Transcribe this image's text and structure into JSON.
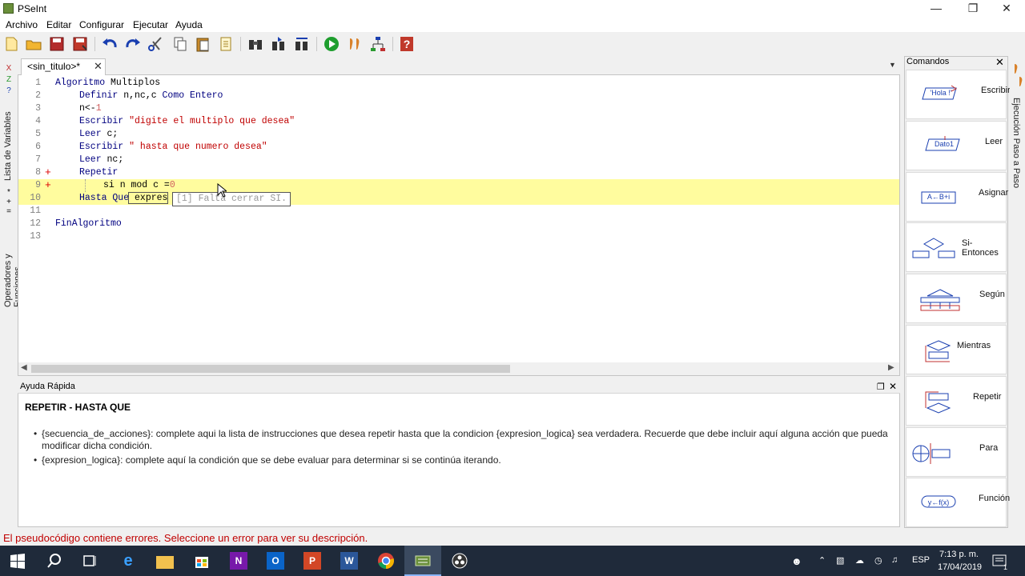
{
  "window": {
    "title": "PSeInt"
  },
  "menu": [
    "Archivo",
    "Editar",
    "Configurar",
    "Ejecutar",
    "Ayuda"
  ],
  "toolbar_icons": [
    "new-file-icon",
    "open-folder-icon",
    "save-icon",
    "save-as-icon",
    "undo-icon",
    "redo-icon",
    "cut-icon",
    "copy-icon",
    "paste-icon",
    "edit-icon",
    "binoculars-icon",
    "find-next-icon",
    "replace-icon",
    "run-icon",
    "step-icon",
    "flowchart-icon",
    "help-icon"
  ],
  "left_tabs": {
    "variables": "Lista de Variables",
    "operators": "Operadores y Funciones"
  },
  "editor": {
    "tab_label": "<sin_titulo>*",
    "lines": [
      {
        "n": "1",
        "parts": [
          [
            "kw",
            "Algoritmo"
          ],
          [
            "var",
            " Multiplos"
          ]
        ],
        "indent": 0
      },
      {
        "n": "2",
        "parts": [
          [
            "kw",
            "Definir"
          ],
          [
            "var",
            " n,nc,c "
          ],
          [
            "kw",
            "Como Entero"
          ]
        ],
        "indent": 1
      },
      {
        "n": "3",
        "parts": [
          [
            "var",
            "n<-"
          ],
          [
            "num",
            "1"
          ]
        ],
        "indent": 1
      },
      {
        "n": "4",
        "parts": [
          [
            "kw",
            "Escribir "
          ],
          [
            "str",
            "\"digite el multiplo que desea\""
          ]
        ],
        "indent": 1
      },
      {
        "n": "5",
        "parts": [
          [
            "kw",
            "Leer"
          ],
          [
            "var",
            " c;"
          ]
        ],
        "indent": 1
      },
      {
        "n": "6",
        "parts": [
          [
            "kw",
            "Escribir "
          ],
          [
            "str",
            "\" hasta que numero desea\""
          ]
        ],
        "indent": 1
      },
      {
        "n": "7",
        "parts": [
          [
            "kw",
            "Leer"
          ],
          [
            "var",
            " nc;"
          ]
        ],
        "indent": 1
      },
      {
        "n": "8",
        "parts": [
          [
            "kw",
            "Repetir"
          ]
        ],
        "indent": 1,
        "fold": "+"
      },
      {
        "n": "9",
        "parts": [
          [
            "var",
            "si n mod c ="
          ],
          [
            "num",
            "0"
          ]
        ],
        "indent": 2,
        "fold": "+",
        "highlight": true
      },
      {
        "n": "10",
        "parts": [
          [
            "kw",
            "Hasta Que"
          ],
          [
            "var",
            " expres"
          ]
        ],
        "indent": 1,
        "highlight": true
      },
      {
        "n": "11",
        "parts": [],
        "indent": 0
      },
      {
        "n": "12",
        "parts": [
          [
            "kw",
            "FinAlgoritmo"
          ]
        ],
        "indent": 0
      },
      {
        "n": "13",
        "parts": [],
        "indent": 0
      }
    ],
    "error_tooltip": "[1] Falta cerrar SI."
  },
  "help": {
    "panel_title": "Ayuda Rápida",
    "heading": "REPETIR - HASTA QUE",
    "bullets": [
      "{secuencia_de_acciones}: complete aqui la lista de instrucciones que desea repetir hasta que la condicion {expresion_logica} sea verdadera. Recuerde que debe incluir aquí alguna acción que pueda modificar dicha condición.",
      "{expresion_logica}: complete aquí la condición que se debe evaluar para determinar si se continúa iterando."
    ]
  },
  "status": "El pseudocódigo contiene errores. Seleccione un error para ver su descripción.",
  "commands": {
    "title": "Comandos",
    "items": [
      {
        "label": "Escribir",
        "icon_text": "'Hola !'"
      },
      {
        "label": "Leer",
        "icon_text": "Dato1"
      },
      {
        "label": "Asignar",
        "icon_text": "A←B+i"
      },
      {
        "label": "Si-Entonces",
        "icon_text": ""
      },
      {
        "label": "Según",
        "icon_text": ""
      },
      {
        "label": "Mientras",
        "icon_text": ""
      },
      {
        "label": "Repetir",
        "icon_text": ""
      },
      {
        "label": "Para",
        "icon_text": ""
      },
      {
        "label": "Función",
        "icon_text": "y←f(x)"
      }
    ]
  },
  "right_tab": "Ejecución Paso a Paso",
  "taskbar": {
    "language": "ESP",
    "time": "7:13 p. m.",
    "date": "17/04/2019",
    "notifications": "1"
  },
  "colors": {
    "keyword": "#000080",
    "string": "#c00000",
    "error": "#c00000",
    "highlight": "#fffc9e"
  }
}
